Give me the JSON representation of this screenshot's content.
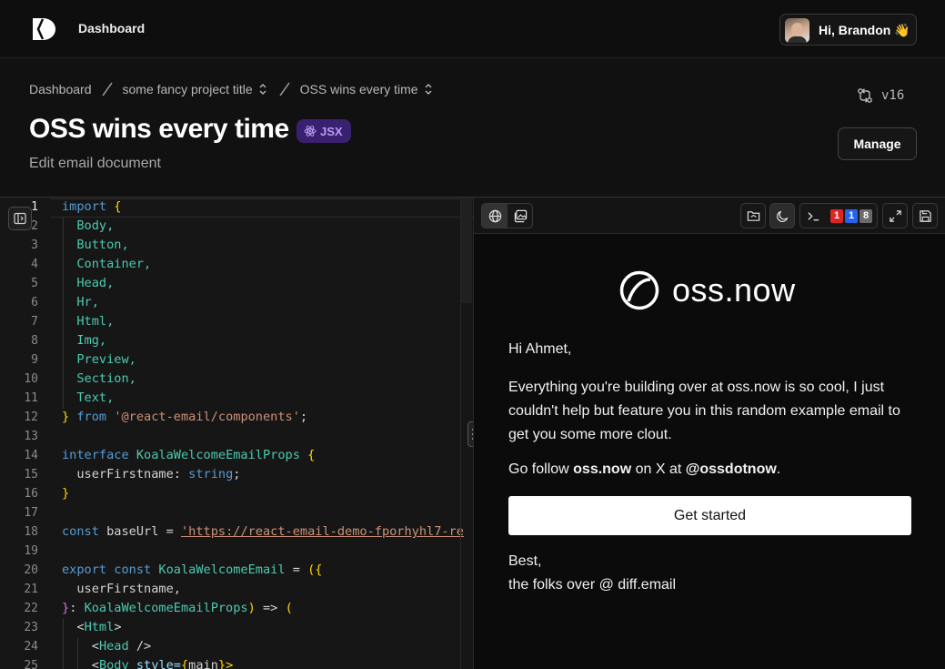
{
  "nav": {
    "title": "Dashboard",
    "greeting": "Hi, Brandon 👋"
  },
  "header": {
    "breadcrumbs": [
      "Dashboard",
      "some fancy project title",
      "OSS wins every time"
    ],
    "title": "OSS wins every time",
    "badge": "JSX",
    "subtitle": "Edit email document",
    "version": "v16",
    "manage_label": "Manage"
  },
  "editor": {
    "lines": [
      "1",
      "2",
      "3",
      "4",
      "5",
      "6",
      "7",
      "8",
      "9",
      "10",
      "11",
      "12",
      "13",
      "14",
      "15",
      "16",
      "17",
      "18",
      "19",
      "20",
      "21",
      "22",
      "23",
      "24",
      "25"
    ],
    "code": {
      "l1a": "import",
      "l1b": "{",
      "l2": "Body,",
      "l3": "Button,",
      "l4": "Container,",
      "l5": "Head,",
      "l6": "Hr,",
      "l7": "Html,",
      "l8": "Img,",
      "l9": "Preview,",
      "l10": "Section,",
      "l11": "Text,",
      "l12a": "}",
      "l12b": "from",
      "l12c": "'@react-email/components'",
      "l12d": ";",
      "l14a": "interface",
      "l14b": "KoalaWelcomeEmailProps",
      "l14c": "{",
      "l15a": "userFirstname",
      "l15b": ":",
      "l15c": "string",
      "l15d": ";",
      "l16": "}",
      "l18a": "const",
      "l18b": "baseUrl =",
      "l18c": "'https://react-email-demo-fporhyhl7-re",
      "l20a": "export",
      "l20b": "const",
      "l20c": "KoalaWelcomeEmail",
      "l20d": "=",
      "l20e": "({",
      "l21": "userFirstname,",
      "l22a": "}",
      "l22b": ":",
      "l22c": "KoalaWelcomeEmailProps",
      "l22d": ")",
      "l22e": "=>",
      "l22f": "(",
      "l23a": "<",
      "l23b": "Html",
      "l23c": ">",
      "l24a": "<",
      "l24b": "Head",
      "l24c": "/>",
      "l25a": "<",
      "l25b": "Body",
      "l25c": "style=",
      "l25d": "{",
      "l25e": "main",
      "l25f": "}>"
    }
  },
  "preview": {
    "toolbar": {
      "badges": [
        "1",
        "1",
        "8"
      ],
      "badge_colors": [
        "#dc2626",
        "#2563eb",
        "#6b6b6b"
      ]
    },
    "email": {
      "brand": "oss.now",
      "salutation": "Hi Ahmet,",
      "body": "Everything you're building over at oss.now is so cool, I just couldn't help but feature you in this random example email to get you some more clout.",
      "follow_pre": "Go follow ",
      "follow_brand": "oss.now",
      "follow_mid": " on X at ",
      "follow_handle": "@ossdotnow",
      "follow_end": ".",
      "cta": "Get started",
      "signoff": "Best,",
      "signature": "the folks over @ diff.email"
    }
  }
}
